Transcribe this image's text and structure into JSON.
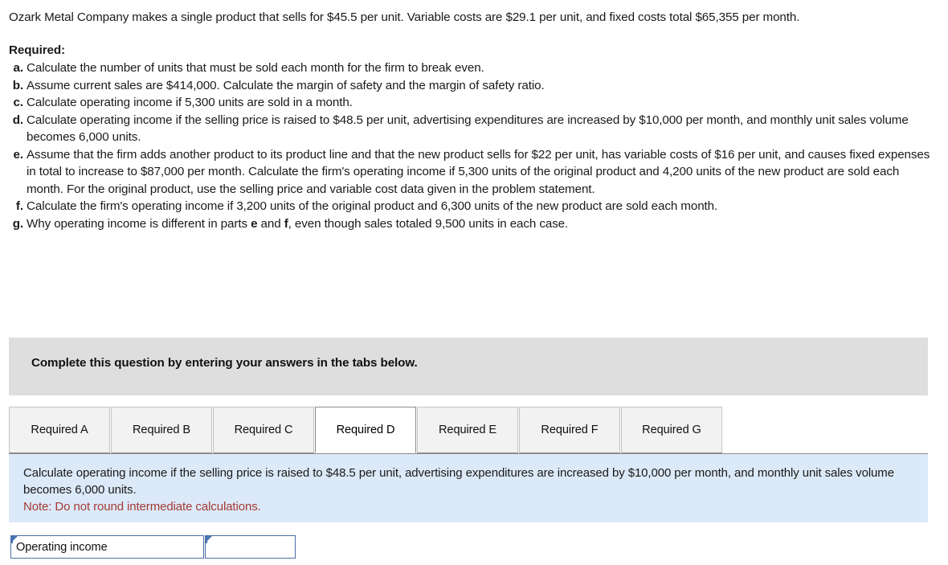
{
  "problem": {
    "intro": "Ozark Metal Company makes a single product that sells for $45.5 per unit. Variable costs are $29.1 per unit, and fixed costs total $65,355 per month.",
    "required_label": "Required:",
    "items": [
      {
        "marker": "a.",
        "text": "Calculate the number of units that must be sold each month for the firm to break even."
      },
      {
        "marker": "b.",
        "text": "Assume current sales are $414,000. Calculate the margin of safety and the margin of safety ratio."
      },
      {
        "marker": "c.",
        "text": "Calculate operating income if 5,300 units are sold in a month."
      },
      {
        "marker": "d.",
        "text": "Calculate operating income if the selling price is raised to $48.5 per unit, advertising expenditures are increased by $10,000 per month, and monthly unit sales volume becomes 6,000 units."
      },
      {
        "marker": "e.",
        "text": "Assume that the firm adds another product to its product line and that the new product sells for $22 per unit, has variable costs of $16 per unit, and causes fixed expenses in total to increase to $87,000 per month. Calculate the firm's operating income if 5,300 units of the original product and 4,200 units of the new product are sold each month. For the original product, use the selling price and variable cost data given in the problem statement."
      },
      {
        "marker": "f.",
        "text": "Calculate the firm's operating income if 3,200 units of the original product and 6,300 units of the new product are sold each month."
      },
      {
        "marker": "g.",
        "text_parts": {
          "before": "Why operating income is different in parts ",
          "bold1": "e",
          "middle": " and ",
          "bold2": "f",
          "after": ", even though sales totaled 9,500 units in each case."
        }
      }
    ]
  },
  "banner": {
    "text": "Complete this question by entering your answers in the tabs below."
  },
  "tabs": {
    "active_index": 3,
    "items": [
      {
        "label": "Required A"
      },
      {
        "label": "Required B"
      },
      {
        "label": "Required C"
      },
      {
        "label": "Required D"
      },
      {
        "label": "Required E"
      },
      {
        "label": "Required F"
      },
      {
        "label": "Required G"
      }
    ]
  },
  "instruction_panel": {
    "text": "Calculate operating income if the selling price is raised to $48.5 per unit, advertising expenditures are increased by $10,000 per month, and monthly unit sales volume becomes 6,000 units.",
    "note": "Note: Do not round intermediate calculations.",
    "note_color": "#a33a33",
    "background_color": "#dce9f8"
  },
  "answer_row": {
    "label": "Operating income",
    "value": "",
    "placeholder": ""
  },
  "colors": {
    "banner_grey": "#dedede",
    "panel_blue": "#dce9f8",
    "cell_border_blue": "#4a6fa5",
    "flag_blue": "#4a74b0"
  }
}
